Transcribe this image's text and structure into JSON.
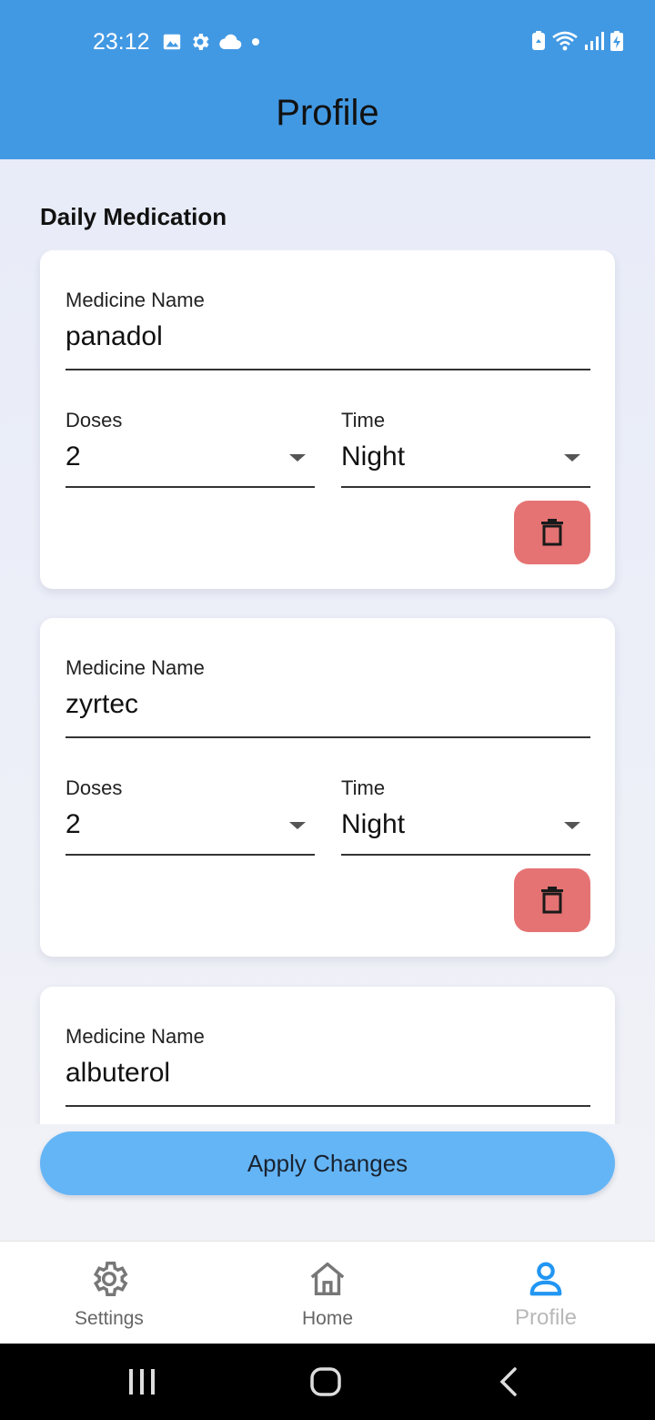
{
  "status_bar": {
    "time": "23:12",
    "left_icons": [
      "image-icon",
      "gear-icon",
      "cloud-icon",
      "dot-icon"
    ],
    "right_icons": [
      "recycle-icon",
      "wifi-icon",
      "signal-icon",
      "battery-icon"
    ]
  },
  "header": {
    "title": "Profile"
  },
  "section": {
    "title": "Daily Medication"
  },
  "medications": [
    {
      "name_label": "Medicine Name",
      "name": "panadol",
      "doses_label": "Doses",
      "doses": "2",
      "time_label": "Time",
      "time": "Night"
    },
    {
      "name_label": "Medicine Name",
      "name": "zyrtec",
      "doses_label": "Doses",
      "doses": "2",
      "time_label": "Time",
      "time": "Night"
    },
    {
      "name_label": "Medicine Name",
      "name": "albuterol"
    }
  ],
  "actions": {
    "apply_label": "Apply Changes"
  },
  "bottom_nav": {
    "items": [
      {
        "label": "Settings",
        "icon": "gear-icon"
      },
      {
        "label": "Home",
        "icon": "home-icon"
      },
      {
        "label": "Profile",
        "icon": "person-icon",
        "active": true
      }
    ]
  },
  "colors": {
    "app_bar": "#4299e3",
    "delete_button": "#e57373",
    "apply_button": "#64b5f6",
    "active_nav_icon": "#2196f3"
  }
}
